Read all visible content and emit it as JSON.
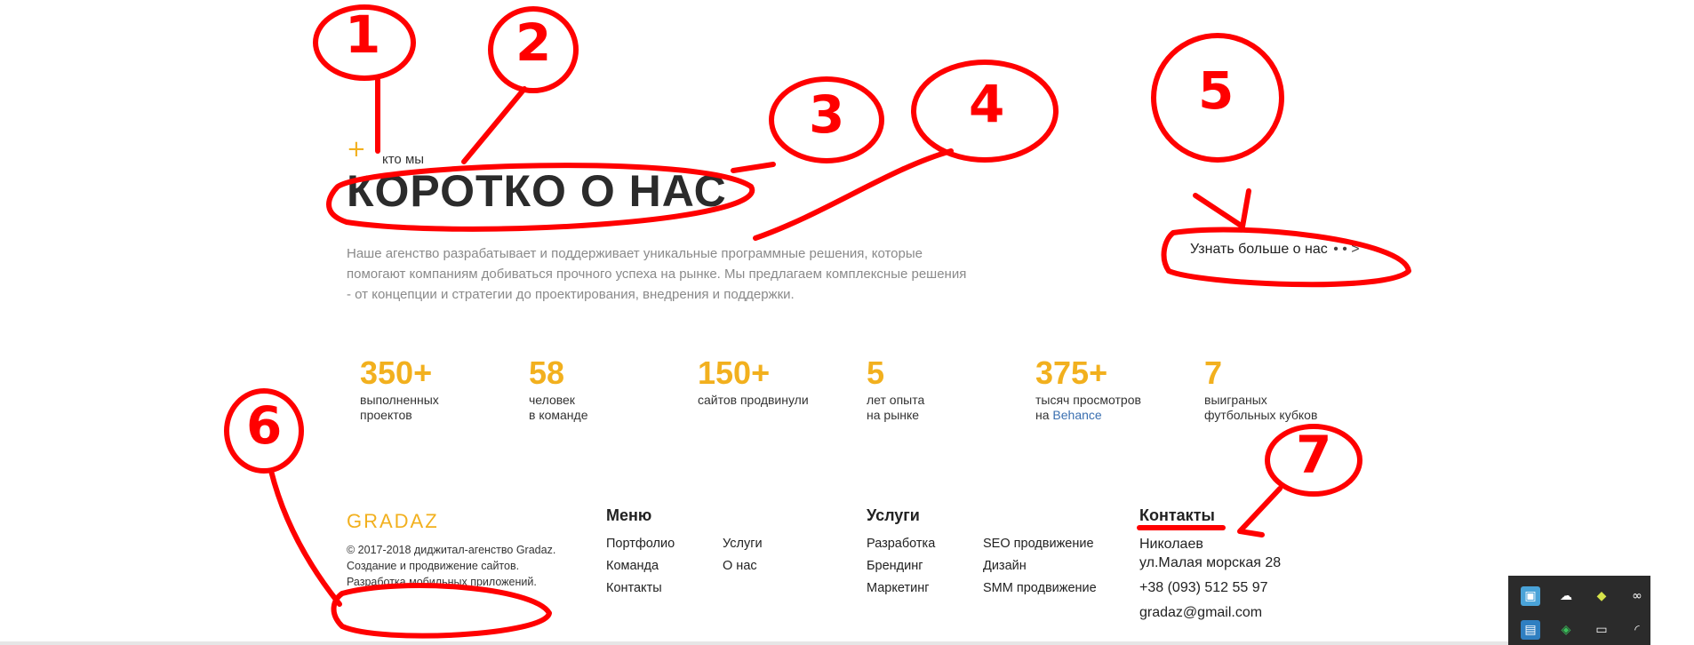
{
  "about": {
    "plus": "+",
    "kicker": "кто мы",
    "title": "КОРОТКО О НАС",
    "description": "Наше агенство разрабатывает и поддерживает уникальные программные решения, которые помогают компаниям добиваться прочного успеха на рынке. Мы предлагаем комплексные решения - от концепции и стратегии до проектирования, внедрения и поддержки.",
    "more_link": "Узнать больше о нас",
    "more_arrow": "• • >"
  },
  "stats": [
    {
      "number": "350+",
      "line1": "выполненных",
      "line2": "проектов"
    },
    {
      "number": "58",
      "line1": "человек",
      "line2": "в команде"
    },
    {
      "number": "150+",
      "line1": "сайтов продвинули",
      "line2": ""
    },
    {
      "number": "5",
      "line1": "лет опыта",
      "line2": "на рынке"
    },
    {
      "number": "375+",
      "line1": "тысяч просмотров",
      "line2_prefix": "на ",
      "line2_link": "Behance"
    },
    {
      "number": "7",
      "line1": "выиграных",
      "line2": "футбольных кубков"
    }
  ],
  "footer": {
    "logo": "GRADAZ",
    "copyright": [
      "© 2017-2018 диджитал-агенство Gradaz.",
      "Создание и продвижение сайтов.",
      "Разработка мобильных приложений."
    ],
    "menu": {
      "heading": "Меню",
      "col1": [
        "Портфолио",
        "Команда",
        "Контакты"
      ],
      "col2": [
        "Услуги",
        "О нас"
      ]
    },
    "services": {
      "heading": "Услуги",
      "col1": [
        "Разработка",
        "Брендинг",
        "Маркетинг"
      ],
      "col2": [
        "SEO продвижение",
        "Дизайн",
        "SMM продвижение"
      ]
    },
    "contacts": {
      "heading": "Контакты",
      "city": "Николаев",
      "street": "ул.Малая морская 28",
      "phone": "+38 (093) 512 55 97",
      "email": "gradaz@gmail.com"
    }
  },
  "annotations": [
    "1",
    "2",
    "3",
    "4",
    "5",
    "6",
    "7"
  ],
  "colors": {
    "accent": "#f2b01e",
    "annotation": "#ff0000",
    "link": "#3a6fb0"
  }
}
